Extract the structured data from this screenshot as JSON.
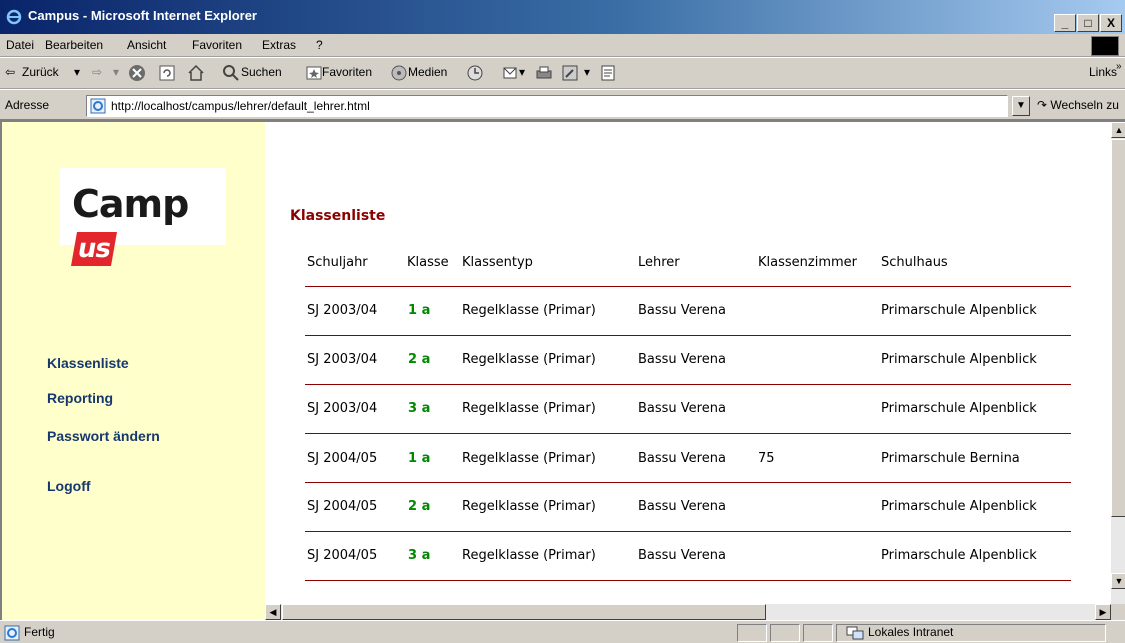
{
  "window": {
    "title": "Campus - Microsoft Internet Explorer",
    "minimize": "_",
    "maximize": "□",
    "close": "X"
  },
  "menu": [
    "Datei",
    "Bearbeiten",
    "Ansicht",
    "Favoriten",
    "Extras",
    "?"
  ],
  "toolbar": {
    "back": "Zurück",
    "search": "Suchen",
    "favorites": "Favoriten",
    "media": "Medien",
    "links": "Links"
  },
  "address": {
    "label": "Adresse",
    "url": "http://localhost/campus/lehrer/default_lehrer.html",
    "go": "Wechseln zu"
  },
  "logo": {
    "text": "Camp",
    "accent": "us"
  },
  "nav": [
    "Klassenliste",
    "Reporting",
    "Passwort ändern",
    "Logoff"
  ],
  "page": {
    "title": "Klassenliste"
  },
  "table": {
    "headers": [
      "Schuljahr",
      "Klasse",
      "Klassentyp",
      "Lehrer",
      "Klassenzimmer",
      "Schulhaus"
    ],
    "rows": [
      [
        "SJ 2003/04",
        "1 a",
        "Regelklasse (Primar)",
        "Bassu Verena",
        "",
        "Primarschule Alpenblick"
      ],
      [
        "SJ 2003/04",
        "2 a",
        "Regelklasse (Primar)",
        "Bassu Verena",
        "",
        "Primarschule Alpenblick"
      ],
      [
        "SJ 2003/04",
        "3 a",
        "Regelklasse (Primar)",
        "Bassu Verena",
        "",
        "Primarschule Alpenblick"
      ],
      [
        "SJ 2004/05",
        "1 a",
        "Regelklasse (Primar)",
        "Bassu Verena",
        "75",
        "Primarschule Bernina"
      ],
      [
        "SJ 2004/05",
        "2 a",
        "Regelklasse (Primar)",
        "Bassu Verena",
        "",
        "Primarschule Alpenblick"
      ],
      [
        "SJ 2004/05",
        "3 a",
        "Regelklasse (Primar)",
        "Bassu Verena",
        "",
        "Primarschule Alpenblick"
      ]
    ]
  },
  "status": {
    "text": "Fertig",
    "zone": "Lokales Intranet"
  },
  "colors": {
    "sidebar": "#ffffcc",
    "nav_link": "#17386e",
    "title": "#8b0000",
    "klasse": "#008800",
    "logo_accent": "#e3262c"
  }
}
